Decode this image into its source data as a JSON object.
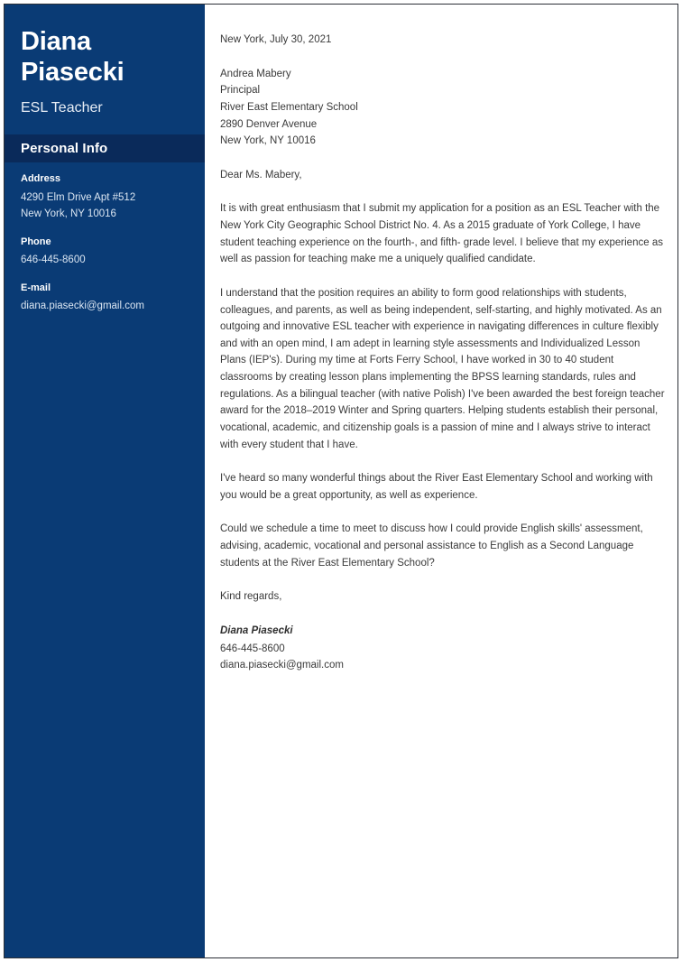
{
  "theme": {
    "sidebar_bg": "#0a3b75",
    "section_band_bg": "#0a2a5a",
    "sidebar_text": "#ffffff",
    "body_text": "#3a3a3a",
    "page_bg": "#ffffff"
  },
  "sidebar": {
    "first_name": "Diana",
    "last_name": "Piasecki",
    "job_title": "ESL Teacher",
    "section_title": "Personal Info",
    "info": [
      {
        "label": "Address",
        "line1": "4290 Elm Drive Apt #512",
        "line2": "New York, NY 10016"
      },
      {
        "label": "Phone",
        "line1": "646-445-8600",
        "line2": ""
      },
      {
        "label": "E-mail",
        "line1": "diana.piasecki@gmail.com",
        "line2": ""
      }
    ]
  },
  "letter": {
    "date": "New York, July 30, 2021",
    "recipient": {
      "name": "Andrea Mabery",
      "role": "Principal",
      "organization": "River East Elementary School",
      "street": "2890 Denver Avenue",
      "city_state_zip": "New York, NY 10016"
    },
    "salutation": "Dear Ms. Mabery,",
    "paragraphs": [
      "It is with great enthusiasm that I submit my application for a position as an ESL Teacher with the New York City Geographic School District No. 4. As a 2015 graduate of York College, I have student teaching experience on the fourth-, and fifth- grade level. I believe that my experience as well as passion for teaching make me a uniquely qualified candidate.",
      "I understand that the position requires an ability to form good relationships with students, colleagues, and parents, as well as being independent, self-starting, and highly motivated. As an outgoing and innovative ESL teacher with experience in navigating differences in culture flexibly and with an open mind, I am adept in learning style assessments and Individualized Lesson Plans (IEP's). During my time at Forts Ferry School, I have worked in 30 to 40 student classrooms by creating lesson plans implementing the BPSS learning standards, rules and regulations. As a bilingual teacher (with native Polish) I've been awarded the best foreign teacher award for the 2018–2019 Winter and Spring quarters. Helping students establish their personal, vocational, academic, and citizenship goals is a passion of mine and I always strive to interact with every student that I have.",
      "I've heard so many wonderful things about the River East Elementary School and working with you would be a great opportunity, as well as experience.",
      "Could we schedule a time to meet to discuss how I could provide English skills' assessment, advising, academic, vocational and personal assistance to English as a Second Language students at the River East Elementary School?"
    ],
    "closing": "Kind regards,",
    "signature": {
      "name": "Diana Piasecki",
      "phone": "646-445-8600",
      "email": "diana.piasecki@gmail.com"
    }
  }
}
